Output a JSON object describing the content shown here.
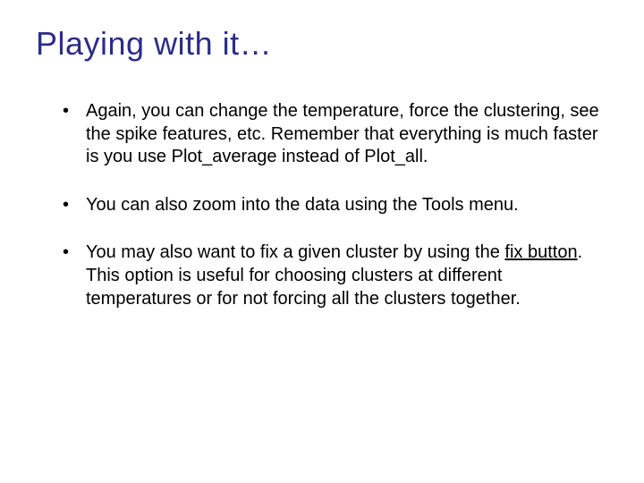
{
  "title": "Playing with it…",
  "bullets": {
    "item1": "Again, you can change the temperature, force the clustering, see the spike features, etc. Remember that everything is much faster is you use Plot_average instead of Plot_all.",
    "item2": "You can also zoom into the data using the Tools menu.",
    "item3_prefix": "You may also want to fix a given cluster by using the ",
    "item3_underlined": "fix button",
    "item3_suffix": ". This option is useful for choosing clusters at different temperatures or for not forcing all the clusters together."
  }
}
